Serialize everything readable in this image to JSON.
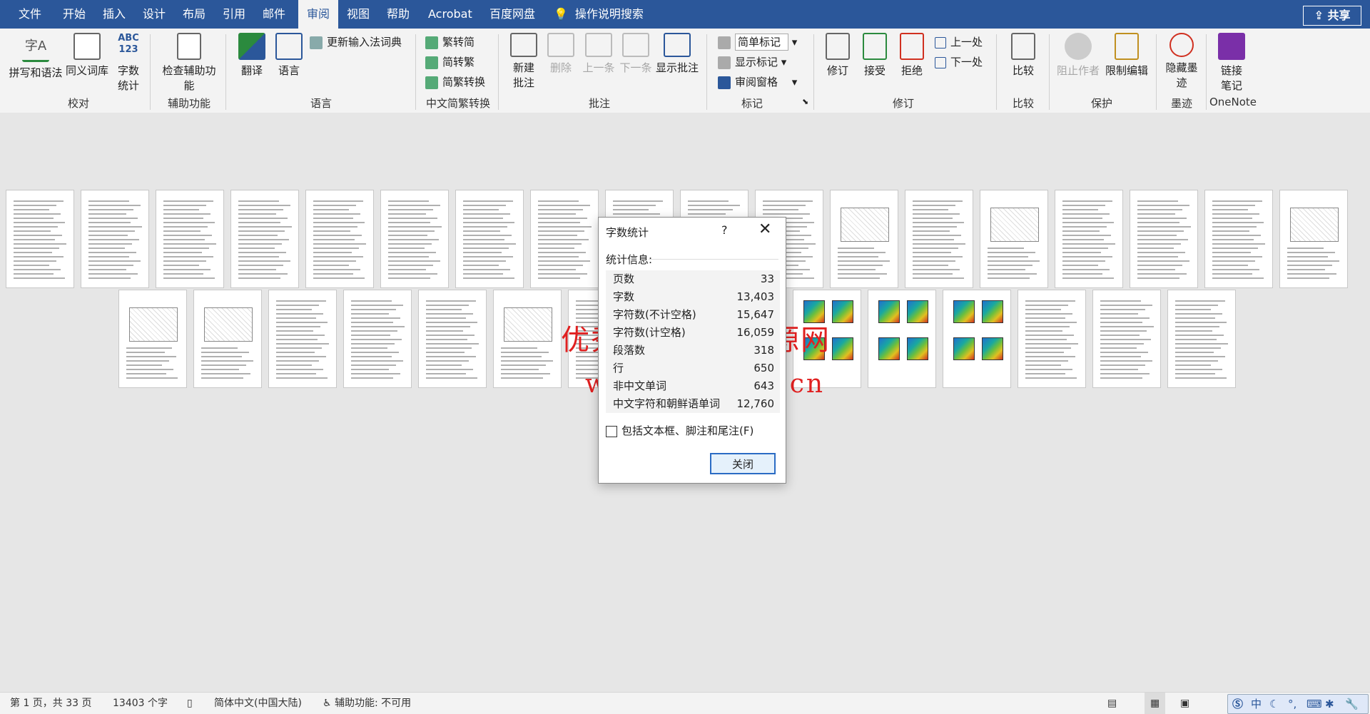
{
  "menu": {
    "tabs": [
      "文件",
      "开始",
      "插入",
      "设计",
      "布局",
      "引用",
      "邮件",
      "审阅",
      "视图",
      "帮助",
      "Acrobat",
      "百度网盘"
    ],
    "active_tab": "审阅",
    "search": "操作说明搜索",
    "share": "共享"
  },
  "ribbon": {
    "groups": {
      "proofing": {
        "label": "校对",
        "spelling": "拼写和语法",
        "thesaurus": "同义词库",
        "wordcount": "字数统计",
        "wordcount_icon_text": "ABC\n123",
        "spelling_icon_text": "字A"
      },
      "accessibility": {
        "label": "辅助功能",
        "check": "检查辅助功能"
      },
      "language": {
        "label": "语言",
        "translate": "翻译",
        "lang": "语言",
        "update_ime": "更新输入法词典"
      },
      "chinese": {
        "label": "中文简繁转换",
        "t2s": "繁转简",
        "s2t": "简转繁",
        "convert": "简繁转换"
      },
      "comments": {
        "label": "批注",
        "new": "新建批注",
        "delete": "删除",
        "prev": "上一条",
        "next": "下一条",
        "show": "显示批注"
      },
      "tracking": {
        "label": "标记",
        "markup": "简单标记",
        "show_markup": "显示标记",
        "pane": "审阅窗格"
      },
      "changes": {
        "label": "修订",
        "track": "修订",
        "accept": "接受",
        "reject": "拒绝",
        "prev": "上一处",
        "next": "下一处"
      },
      "compare": {
        "label": "比较",
        "compare": "比较"
      },
      "protect": {
        "label": "保护",
        "block": "阻止作者",
        "restrict": "限制编辑"
      },
      "ink": {
        "label": "墨迹",
        "hide": "隐藏墨迹"
      },
      "onenote": {
        "label": "OneNote",
        "link": "链接笔记"
      }
    }
  },
  "watermark": {
    "line1": "优秀毕业设计资源网",
    "line2": "www.keyicad.cn"
  },
  "dialog": {
    "title": "字数统计",
    "help": "?",
    "section": "统计信息:",
    "stats": [
      {
        "k": "页数",
        "v": "33"
      },
      {
        "k": "字数",
        "v": "13,403"
      },
      {
        "k": "字符数(不计空格)",
        "v": "15,647"
      },
      {
        "k": "字符数(计空格)",
        "v": "16,059"
      },
      {
        "k": "段落数",
        "v": "318"
      },
      {
        "k": "行",
        "v": "650"
      },
      {
        "k": "非中文单词",
        "v": "643"
      },
      {
        "k": "中文字符和朝鲜语单词",
        "v": "12,760"
      }
    ],
    "checkbox": "包括文本框、脚注和尾注(F)",
    "close_button": "关闭"
  },
  "status": {
    "page": "第 1 页，共 33 页",
    "words": "13403 个字",
    "lang": "简体中文(中国大陆)",
    "access": "辅助功能: 不可用",
    "ime": "中"
  }
}
